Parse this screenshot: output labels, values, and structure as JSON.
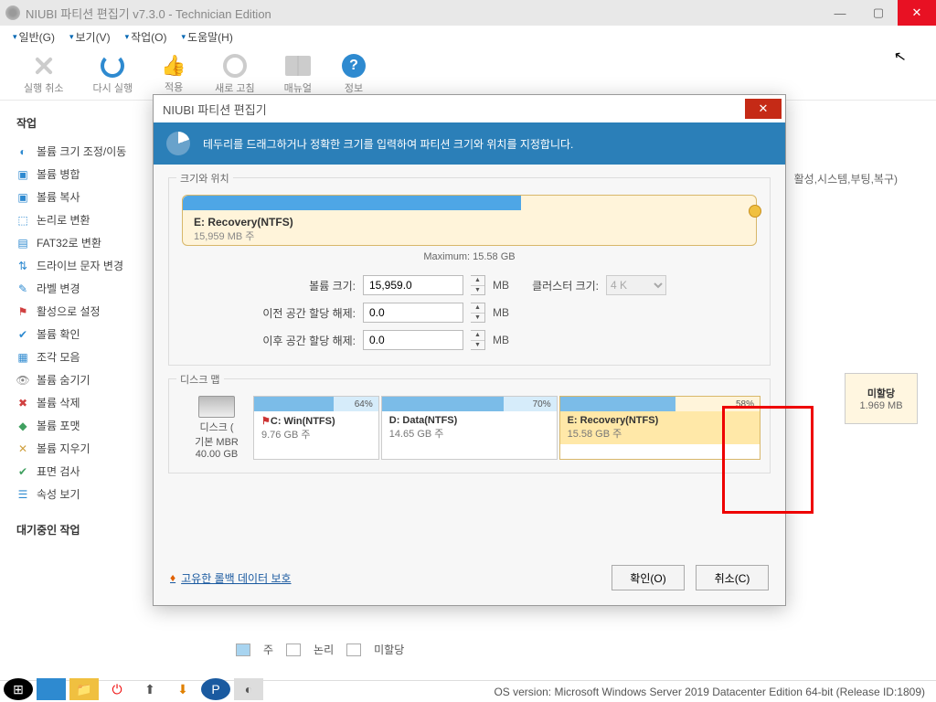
{
  "title": "NIUBI 파티션 편집기 v7.3.0 - Technician Edition",
  "menu": {
    "general": "일반(G)",
    "view": "보기(V)",
    "ops": "작업(O)",
    "help": "도움말(H)"
  },
  "toolbar": {
    "undo": "실행 취소",
    "redo": "다시 실행",
    "apply": "적용",
    "refresh": "새로 고침",
    "manual": "매뉴얼",
    "info": "정보"
  },
  "sidebar": {
    "ops_title": "작업",
    "items": [
      "볼륨 크기 조정/이동",
      "볼륨 병합",
      "볼륨 복사",
      "논리로 변환",
      "FAT32로 변환",
      "드라이브 문자 변경",
      "라벨 변경",
      "활성으로 설정",
      "볼륨 확인",
      "조각 모음",
      "볼륨 숨기기",
      "볼륨 삭제",
      "볼륨 포맷",
      "볼륨 지우기",
      "표면 검사",
      "속성 보기"
    ],
    "pending_title": "대기중인 작업"
  },
  "bg": {
    "flags": "활성,시스템,부팅,복구)",
    "unalloc": {
      "title": "미할당",
      "size": "1.969 MB"
    }
  },
  "dialog": {
    "title": "NIUBI 파티션 편집기",
    "banner": "테두리를 드래그하거나 정확한 크기를 입력하여 파티션 크기와 위치를 지정합니다.",
    "gb_size": "크기와 위치",
    "slider": {
      "name": "E: Recovery(NTFS)",
      "size": "15,959 MB 주",
      "max": "Maximum: 15.58 GB"
    },
    "form": {
      "vol_size_lbl": "볼륨 크기:",
      "vol_size": "15,959.0",
      "before_lbl": "이전 공간 할당 해제:",
      "before": "0.0",
      "after_lbl": "이후 공간 할당 해제:",
      "after": "0.0",
      "unit": "MB",
      "cluster_lbl": "클러스터 크기:",
      "cluster": "4 K"
    },
    "gb_map": "디스크 맵",
    "disk": {
      "name": "디스크 (",
      "type": "기본 MBR",
      "size": "40.00 GB"
    },
    "parts": [
      {
        "pct": "64%",
        "name": "C: Win(NTFS)",
        "size": "9.76 GB 주",
        "flag": true,
        "used": 64
      },
      {
        "pct": "70%",
        "name": "D: Data(NTFS)",
        "size": "14.65 GB 주",
        "used": 70
      },
      {
        "pct": "58%",
        "name": "E: Recovery(NTFS)",
        "size": "15.58 GB 주",
        "used": 58,
        "sel": true
      }
    ],
    "rollback": "고유한 롤백 데이터 보호",
    "ok": "확인(O)",
    "cancel": "취소(C)"
  },
  "legend": {
    "primary": "주",
    "logical": "논리",
    "unalloc": "미할당"
  },
  "status": {
    "os": "OS version: Microsoft Windows Server 2019 Datacenter Edition  64-bit  (Release ID:1809)"
  }
}
